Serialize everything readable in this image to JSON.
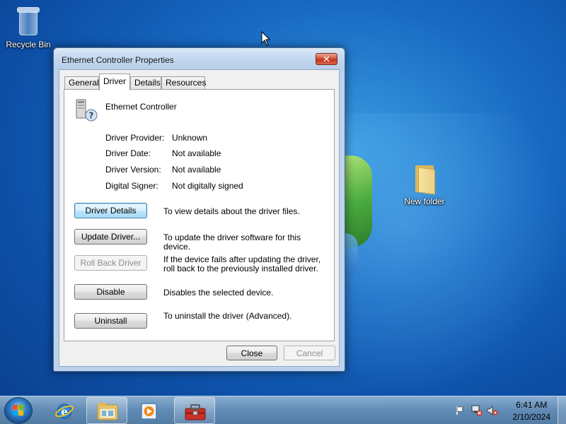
{
  "desktop": {
    "icons": [
      {
        "label": "Recycle Bin",
        "icon": "recycle-bin-icon"
      },
      {
        "label": "New folder",
        "icon": "folder-icon"
      }
    ]
  },
  "dialog": {
    "title": "Ethernet Controller Properties",
    "close_glyph": "✕",
    "tabs": [
      {
        "label": "General"
      },
      {
        "label": "Driver",
        "active": true
      },
      {
        "label": "Details"
      },
      {
        "label": "Resources"
      }
    ],
    "device_name": "Ethernet Controller",
    "info": [
      {
        "label": "Driver Provider:",
        "value": "Unknown"
      },
      {
        "label": "Driver Date:",
        "value": "Not available"
      },
      {
        "label": "Driver Version:",
        "value": "Not available"
      },
      {
        "label": "Digital Signer:",
        "value": "Not digitally signed"
      }
    ],
    "actions": [
      {
        "button": "Driver Details",
        "description": "To view details about the driver files.",
        "state": "focused"
      },
      {
        "button": "Update Driver...",
        "description": "To update the driver software for this device.",
        "state": "enabled"
      },
      {
        "button": "Roll Back Driver",
        "description": "If the device fails after updating the driver, roll back to the previously installed driver.",
        "state": "disabled"
      },
      {
        "button": "Disable",
        "description": "Disables the selected device.",
        "state": "enabled"
      },
      {
        "button": "Uninstall",
        "description": "To uninstall the driver (Advanced).",
        "state": "enabled"
      }
    ],
    "footer": {
      "close_label": "Close",
      "cancel_label": "Cancel"
    }
  },
  "taskbar": {
    "items": [
      {
        "icon": "internet-explorer-icon"
      },
      {
        "icon": "windows-explorer-icon"
      },
      {
        "icon": "media-player-icon"
      },
      {
        "icon": "toolbox-icon"
      }
    ],
    "tray_icons": [
      "action-center-flag-icon",
      "network-icon",
      "volume-muted-icon"
    ],
    "time": "6:41 AM",
    "date": "2/10/2024"
  },
  "colors": {
    "desktop_blue": "#1769c2",
    "close_red": "#c2341c",
    "focused_button": "#bee6fd"
  }
}
